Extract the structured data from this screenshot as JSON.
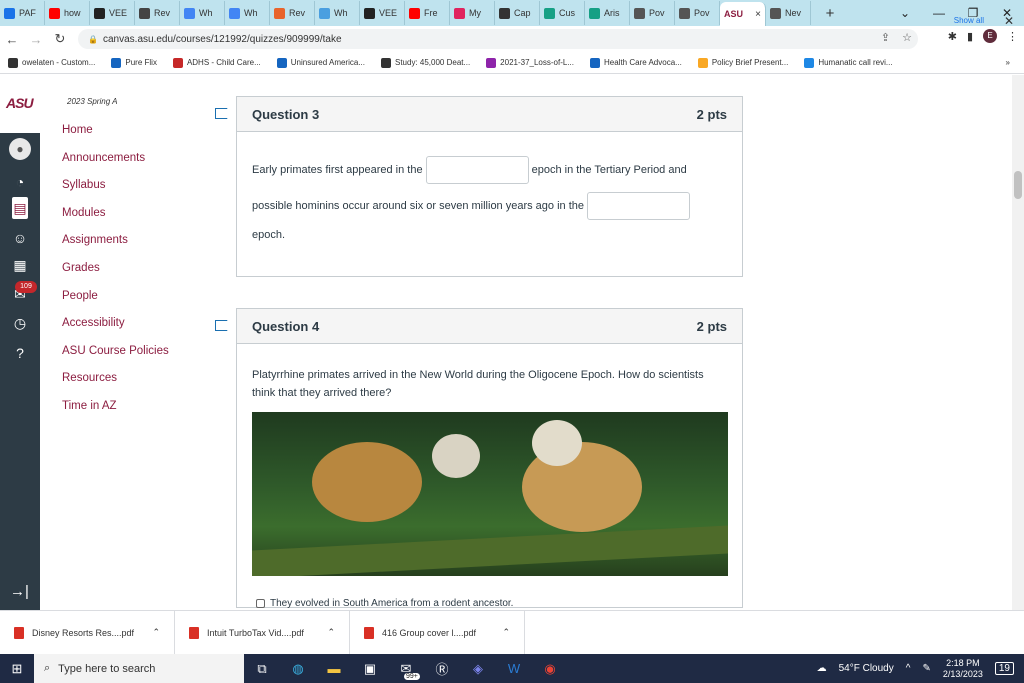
{
  "tabs": [
    {
      "label": "PAF",
      "color": "#1a73e8"
    },
    {
      "label": "how",
      "color": "#ff0000"
    },
    {
      "label": "VEE",
      "color": "#222222"
    },
    {
      "label": "Rev",
      "color": "#444444"
    },
    {
      "label": "Wh",
      "color": "#4285f4"
    },
    {
      "label": "Wh",
      "color": "#4285f4"
    },
    {
      "label": "Rev",
      "color": "#e8642c"
    },
    {
      "label": "Wh",
      "color": "#4a9fe0"
    },
    {
      "label": "VEE",
      "color": "#222222"
    },
    {
      "label": "Fre",
      "color": "#ff0000"
    },
    {
      "label": "My",
      "color": "#e0245e"
    },
    {
      "label": "Cap",
      "color": "#333333"
    },
    {
      "label": "Cus",
      "color": "#16a085"
    },
    {
      "label": "Aris",
      "color": "#16a085"
    },
    {
      "label": "Pov",
      "color": "#555555"
    },
    {
      "label": "Pov",
      "color": "#555555"
    }
  ],
  "active_tab": {
    "label": "ASU",
    "close": "×"
  },
  "last_tab": {
    "label": "Nev"
  },
  "url": "canvas.asu.edu/courses/121992/quizzes/909999/take",
  "profile_initial": "E",
  "bookmarks": [
    {
      "label": "owelaten - Custom...",
      "color": "#333333"
    },
    {
      "label": "Pure Flix",
      "color": "#1565c0"
    },
    {
      "label": "ADHS - Child Care...",
      "color": "#c62828"
    },
    {
      "label": "Uninsured America...",
      "color": "#1565c0"
    },
    {
      "label": "Study: 45,000 Deat...",
      "color": "#333333"
    },
    {
      "label": "2021-37_Loss-of-L...",
      "color": "#8e24aa"
    },
    {
      "label": "Health Care Advoca...",
      "color": "#1565c0"
    },
    {
      "label": "Policy Brief Present...",
      "color": "#f9a825"
    },
    {
      "label": "Humanatic call revi...",
      "color": "#1e88e5"
    }
  ],
  "badge_count": "109",
  "course": {
    "term": "2023 Spring A",
    "nav": [
      "Home",
      "Announcements",
      "Syllabus",
      "Modules",
      "Assignments",
      "Grades",
      "People",
      "Accessibility",
      "ASU Course Policies",
      "Resources",
      "Time in AZ"
    ]
  },
  "q3": {
    "title": "Question 3",
    "points": "2 pts",
    "text1": "Early primates first appeared in the",
    "text2": "epoch in the Tertiary Period and",
    "text3": "possible hominins occur around six or seven million years ago in the",
    "text4": "epoch."
  },
  "q4": {
    "title": "Question 4",
    "points": "2 pts",
    "prompt": "Platyrrhine primates arrived in the New World during the Oligocene Epoch. How do scientists think that they arrived there?",
    "option1": "They evolved in South America from a rodent ancestor."
  },
  "downloads": [
    {
      "label": "Disney Resorts Res....pdf"
    },
    {
      "label": "Intuit TurboTax Vid....pdf"
    },
    {
      "label": "416 Group cover l....pdf"
    }
  ],
  "show_all": "Show all",
  "taskbar": {
    "search_placeholder": "Type here to search",
    "mail_badge": "99+",
    "weather": "54°F  Cloudy",
    "time": "2:18 PM",
    "date": "2/13/2023",
    "notif_count": "19"
  }
}
